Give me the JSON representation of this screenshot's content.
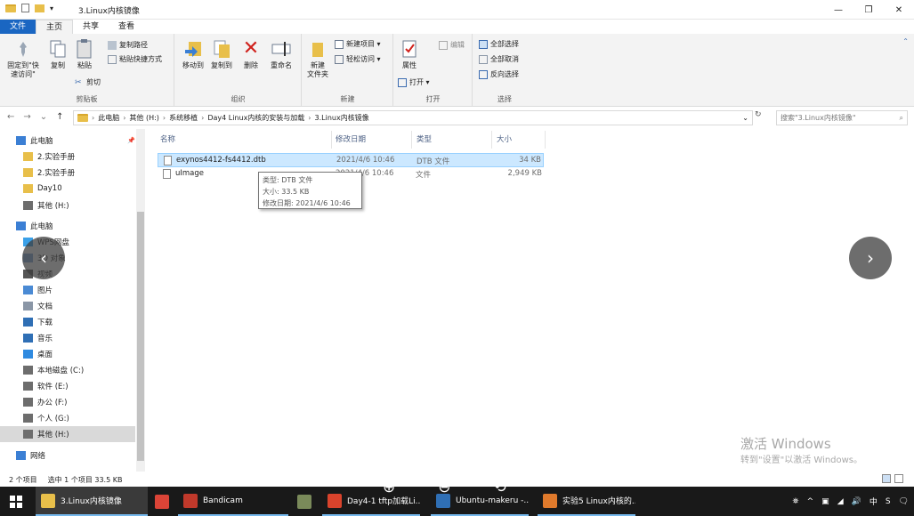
{
  "window": {
    "title": "3.Linux内核镜像",
    "controls": {
      "minimize": "—",
      "maximize": "❐",
      "close": "✕"
    }
  },
  "tabs": [
    "文件",
    "主页",
    "共享",
    "查看"
  ],
  "ribbon": {
    "clipboard": {
      "pin": "固定到\"快\n速访问\"",
      "copy": "复制",
      "paste": "粘贴",
      "copy_path": "复制路径",
      "paste_shortcut": "粘贴快捷方式",
      "cut": "剪切",
      "label": "剪贴板"
    },
    "organize": {
      "move_to": "移动到",
      "copy_to": "复制到",
      "delete": "删除",
      "rename": "重命名",
      "label": "组织"
    },
    "new": {
      "new_folder": "新建\n文件夹",
      "new_item": "新建项目 ▾",
      "easy_access": "轻松访问 ▾",
      "label": "新建"
    },
    "open": {
      "properties": "属性",
      "open": "打开 ▾",
      "edit": "编辑",
      "label": "打开"
    },
    "select": {
      "select_all": "全部选择",
      "select_none": "全部取消",
      "invert": "反向选择",
      "label": "选择"
    }
  },
  "nav_arrows": [
    "←",
    "→",
    "⌄",
    "↑"
  ],
  "address": {
    "crumbs": [
      "此电脑",
      "其他 (H:)",
      "系统移植",
      "Day4 Linux内核的安装与加载",
      "3.Linux内核镜像"
    ],
    "separator": "›",
    "dropdown": "⌄",
    "refresh": "↻"
  },
  "search": {
    "placeholder": "搜索\"3.Linux内核镜像\"",
    "icon": "⌕"
  },
  "nav_pane": {
    "items": [
      {
        "label": "此电脑",
        "icon": "pc-icon",
        "pin": "📌"
      },
      {
        "label": "2.实验手册",
        "icon": "folder-icon"
      },
      {
        "label": "2.实验手册",
        "icon": "folder-icon"
      },
      {
        "label": "Day10",
        "icon": "folder-icon"
      },
      {
        "label": "其他 (H:)",
        "icon": "drive-icon"
      },
      {
        "label": "此电脑",
        "icon": "pc-icon"
      },
      {
        "label": "WPS网盘",
        "icon": "cloud-icon"
      },
      {
        "label": "3D 对象",
        "icon": "cube-icon"
      },
      {
        "label": "视频",
        "icon": "video-icon"
      },
      {
        "label": "图片",
        "icon": "image-icon"
      },
      {
        "label": "文档",
        "icon": "document-icon"
      },
      {
        "label": "下载",
        "icon": "download-icon"
      },
      {
        "label": "音乐",
        "icon": "music-icon"
      },
      {
        "label": "桌面",
        "icon": "desktop-icon"
      },
      {
        "label": "本地磁盘 (C:)",
        "icon": "drive-icon"
      },
      {
        "label": "软件 (E:)",
        "icon": "drive-icon"
      },
      {
        "label": "办公 (F:)",
        "icon": "drive-icon"
      },
      {
        "label": "个人 (G:)",
        "icon": "drive-icon"
      },
      {
        "label": "其他 (H:)",
        "icon": "drive-icon"
      },
      {
        "label": "网络",
        "icon": "network-icon"
      }
    ]
  },
  "file_list": {
    "columns": [
      "名称",
      "修改日期",
      "类型",
      "大小"
    ],
    "rows": [
      {
        "name": "exynos4412-fs4412.dtb",
        "date": "2021/4/6 10:46",
        "type": "DTB 文件",
        "size": "34 KB",
        "selected": true
      },
      {
        "name": "uImage",
        "date": "2021/4/6 10:46",
        "type": "文件",
        "size": "2,949 KB",
        "selected": false
      }
    ],
    "tooltip": {
      "type": "类型: DTB 文件",
      "size": "大小: 33.5 KB",
      "modified": "修改日期: 2021/4/6 10:46"
    }
  },
  "overlay": {
    "prev": "‹",
    "next": "›",
    "watermark_title": "激活 Windows",
    "watermark_sub": "转到\"设置\"以激活 Windows。"
  },
  "status": {
    "count": "2 个项目",
    "selected": "选中 1 个项目  33.5 KB"
  },
  "taskbar": {
    "items": [
      {
        "label": "3.Linux内核镜像",
        "color": "#e8bf4a"
      },
      {
        "label": "",
        "color": "#db4437"
      },
      {
        "label": "Bandicam",
        "color": "#c0392b"
      },
      {
        "label": "",
        "color": "#7a8a5a"
      },
      {
        "label": "Day4-1 tftp加载Li...",
        "color": "#d9432c"
      },
      {
        "label": "Ubuntu-makeru -...",
        "color": "#2f6fb5"
      },
      {
        "label": "实验5 Linux内核的...",
        "color": "#e07a2c"
      }
    ],
    "zoom_in": "⊕",
    "zoom_out": "⊖",
    "rotate": "⟲",
    "tray": [
      "⛯",
      "^",
      "▣",
      "◢",
      "🔊",
      "中",
      "S",
      "🗨"
    ],
    "ime": "中"
  }
}
